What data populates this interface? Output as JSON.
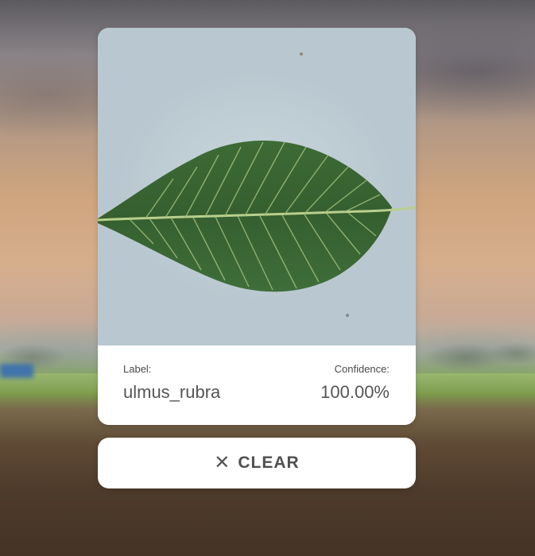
{
  "result_card": {
    "image_alt": "Uploaded leaf photo",
    "label_title": "Label:",
    "label_value": "ulmus_rubra",
    "confidence_title": "Confidence:",
    "confidence_value": "100.00%"
  },
  "clear_button": {
    "icon": "close-icon",
    "label": "CLEAR"
  },
  "colors": {
    "card_background": "#ffffff",
    "text_primary": "#555555",
    "leaf_green": "#3f6b38"
  }
}
